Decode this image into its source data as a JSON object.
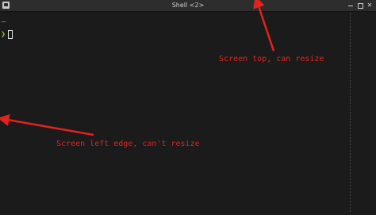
{
  "window": {
    "title": "Shell <2>",
    "controls": [
      "minimize",
      "maximize",
      "close"
    ],
    "close_glyph": "✕"
  },
  "terminal": {
    "previous_output": "–",
    "prompt_symbol": "❯",
    "cursor_icon": "block-cursor",
    "prompt_color": "#8fbf3a"
  },
  "annotations": {
    "color": "#e0231c",
    "top_label": "Screen top, can resize",
    "left_label": "Screen left edge, can't resize"
  }
}
